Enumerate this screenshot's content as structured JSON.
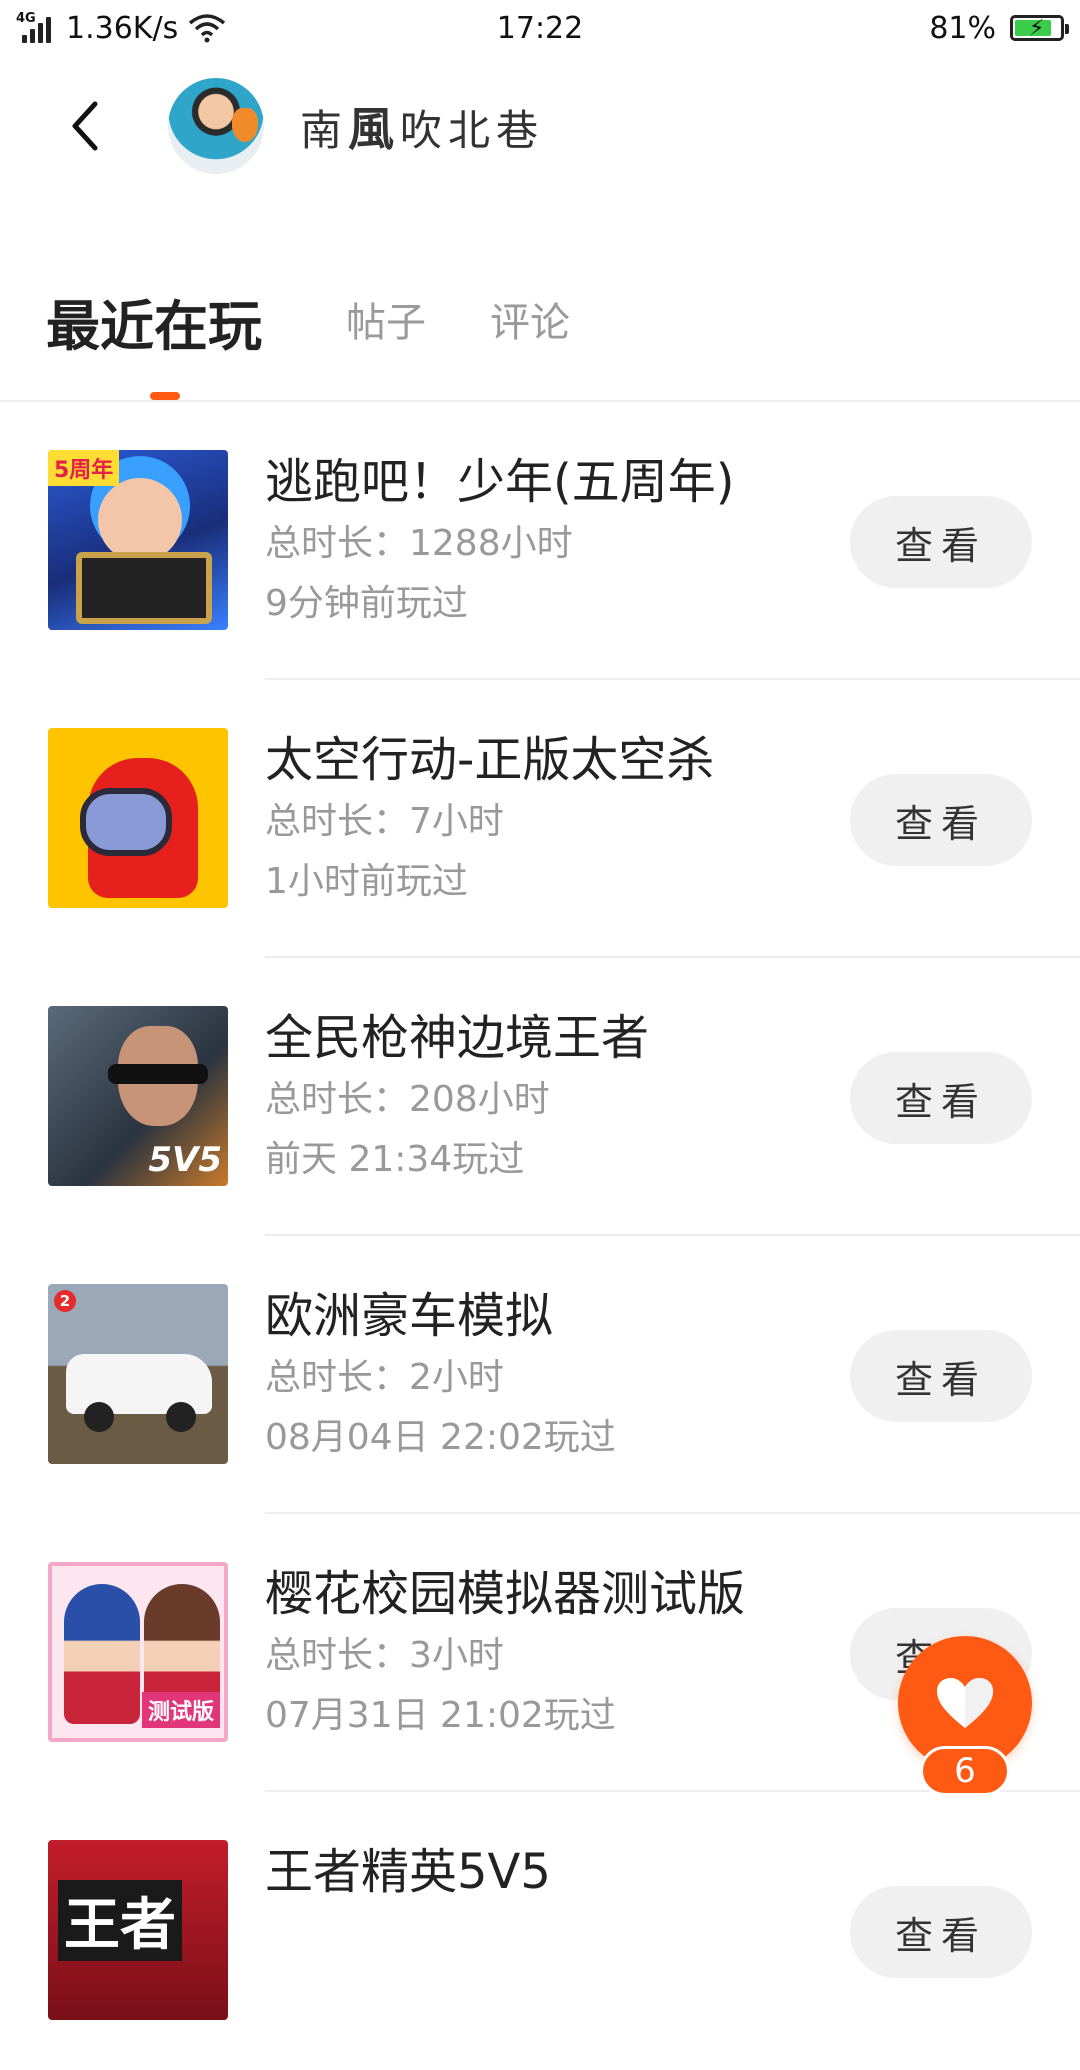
{
  "status_bar": {
    "network": "4G",
    "speed": "1.36K/s",
    "time": "17:22",
    "battery": "81%",
    "battery_level": 0.81,
    "battery_color": "#3ccc4b"
  },
  "header": {
    "username_prefix": "南",
    "username_bold": "風",
    "username_suffix": "吹北巷"
  },
  "tabs": [
    {
      "label": "最近在玩",
      "active": true
    },
    {
      "label": "帖子",
      "active": false
    },
    {
      "label": "评论",
      "active": false
    }
  ],
  "accent_color": "#ff5a14",
  "games": [
    {
      "name": "逃跑吧！少年(五周年)",
      "duration": "总时长：1288小时",
      "last_played": "9分钟前玩过",
      "button": "查看"
    },
    {
      "name": "太空行动-正版太空杀",
      "duration": "总时长：7小时",
      "last_played": "1小时前玩过",
      "button": "查看"
    },
    {
      "name": "全民枪神边境王者",
      "duration": "总时长：208小时",
      "last_played": "前天 21:34玩过",
      "button": "查看"
    },
    {
      "name": "欧洲豪车模拟",
      "duration": "总时长：2小时",
      "last_played": "08月04日 22:02玩过",
      "button": "查看"
    },
    {
      "name": "樱花校园模拟器测试版",
      "duration": "总时长：3小时",
      "last_played": "07月31日 21:02玩过",
      "button": "查看"
    },
    {
      "name": "王者精英5V5",
      "duration": "",
      "last_played": "",
      "button": "查看"
    }
  ],
  "thumb_labels": {
    "t1": "5周年",
    "t3": "5V5",
    "t4": "2",
    "t5": "测试版",
    "t6": "王者"
  },
  "fab": {
    "icon": "heart-icon",
    "count": "6"
  }
}
